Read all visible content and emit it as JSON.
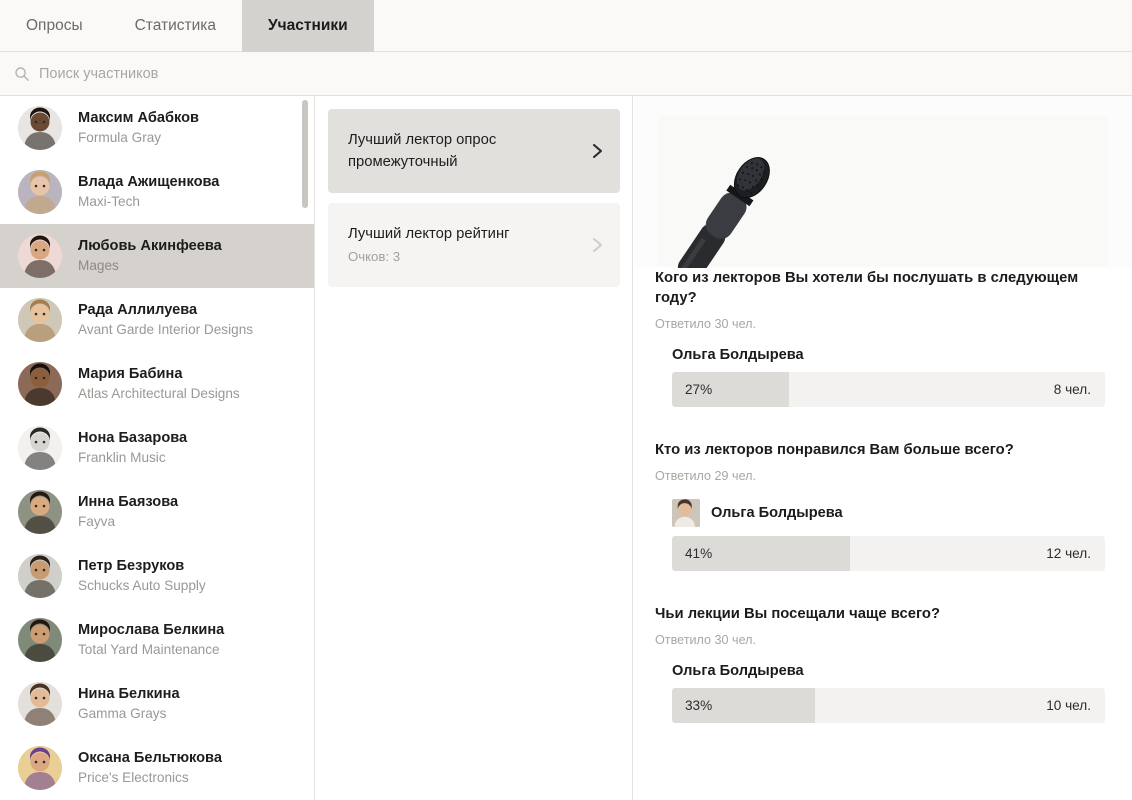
{
  "tabs": [
    {
      "label": "Опросы",
      "active": false
    },
    {
      "label": "Статистика",
      "active": false
    },
    {
      "label": "Участники",
      "active": true
    }
  ],
  "search": {
    "placeholder": "Поиск участников",
    "value": "",
    "icon": "search-icon"
  },
  "people": [
    {
      "name": "Максим Абабков",
      "org": "Formula Gray",
      "selected": false,
      "skin": "#6b4a33",
      "hair": "#1d1410",
      "bg": "#e8e6e2"
    },
    {
      "name": "Влада Ажищенкова",
      "org": "Maxi-Tech",
      "selected": false,
      "skin": "#e8c4a8",
      "hair": "#c9a06a",
      "bg": "#b9b4bd"
    },
    {
      "name": "Любовь Акинфеева",
      "org": "Mages",
      "selected": true,
      "skin": "#d9a882",
      "hair": "#21150f",
      "bg": "#efd9d6"
    },
    {
      "name": "Рада Аллилуева",
      "org": "Avant Garde Interior Designs",
      "selected": false,
      "skin": "#e7c29c",
      "hair": "#a87d4e",
      "bg": "#cfc7b8"
    },
    {
      "name": "Мария Бабина",
      "org": "Atlas Architectural Designs",
      "selected": false,
      "skin": "#8b5e3c",
      "hair": "#17100c",
      "bg": "#8c6a58"
    },
    {
      "name": "Нона Базарова",
      "org": "Franklin Music",
      "selected": false,
      "skin": "#d8d5d1",
      "hair": "#2a2724",
      "bg": "#f2f1ef"
    },
    {
      "name": "Инна Баязова",
      "org": "Fayva",
      "selected": false,
      "skin": "#d9a97f",
      "hair": "#241812",
      "bg": "#8e9283"
    },
    {
      "name": "Петр Безруков",
      "org": "Schucks Auto Supply",
      "selected": false,
      "skin": "#c99b72",
      "hair": "#2c2018",
      "bg": "#cfd0cb"
    },
    {
      "name": "Мирослава Белкина",
      "org": "Total Yard Maintenance",
      "selected": false,
      "skin": "#cf9d73",
      "hair": "#231711",
      "bg": "#7f8a78"
    },
    {
      "name": "Нина Белкина",
      "org": "Gamma Grays",
      "selected": false,
      "skin": "#e4bb96",
      "hair": "#4a3322",
      "bg": "#e3e0db"
    },
    {
      "name": "Оксана Бельтюкова",
      "org": "Price's Electronics",
      "selected": false,
      "skin": "#dba882",
      "hair": "#6a3f8e",
      "bg": "#e9cf94"
    }
  ],
  "scroll": {
    "thumb_label": "people-scrollbar"
  },
  "surveys": [
    {
      "title": "Лучший лектор опрос промежуточный",
      "sub": "",
      "active": true,
      "chevron": "chevron-right-icon"
    },
    {
      "title": "Лучший лектор рейтинг",
      "sub": "Очков: 3",
      "active": false,
      "chevron": "chevron-right-icon"
    }
  ],
  "hero": {
    "alt": "microphone-image"
  },
  "questions": [
    {
      "title": "Кого из лекторов Вы хотели бы послушать в следующем году?",
      "meta": "Ответило 30 чел.",
      "has_avatar": false,
      "answer": "Ольга Болдырева",
      "percent": "27%",
      "percent_value": 27,
      "count": "8 чел."
    },
    {
      "title": "Кто из лекторов понравился Вам больше всего?",
      "meta": "Ответило 29 чел.",
      "has_avatar": true,
      "answer": "Ольга Болдырева",
      "percent": "41%",
      "percent_value": 41,
      "count": "12 чел."
    },
    {
      "title": "Чьи лекции Вы посещали чаще всего?",
      "meta": "Ответило 30 чел.",
      "has_avatar": false,
      "answer": "Ольга Болдырева",
      "percent": "33%",
      "percent_value": 33,
      "count": "10 чел."
    }
  ],
  "colors": {
    "active_tab_bg": "#d4d2ce",
    "selected_row_bg": "#d5d2cd",
    "bar_track": "#f3f2f0",
    "bar_fill": "#dddbd7",
    "header_bg": "#faf9f8",
    "muted_text": "#9b9894"
  }
}
